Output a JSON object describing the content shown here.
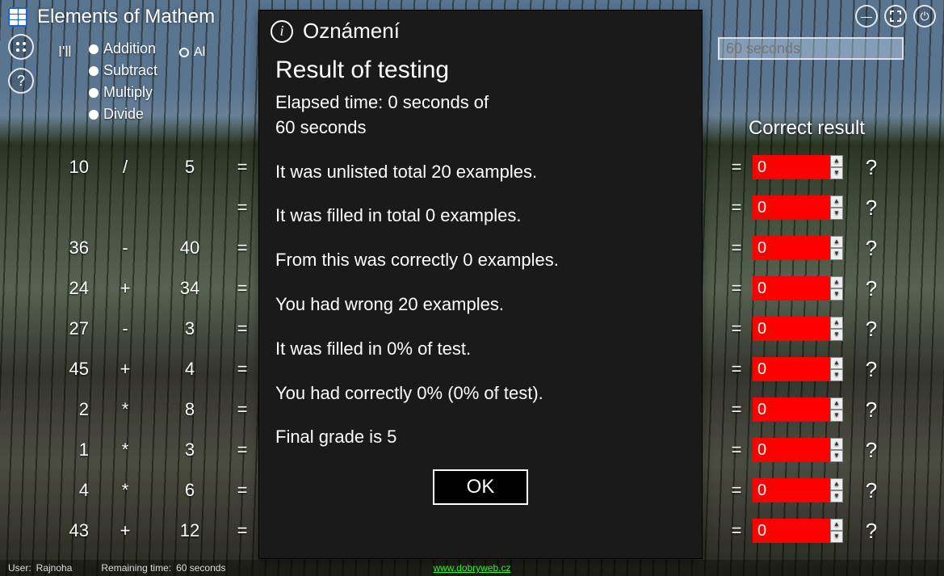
{
  "app": {
    "title": "Elements of Mathem",
    "options_label": "I'll",
    "operations": [
      "Addition",
      "Subtract",
      "Multiply",
      "Divide"
    ],
    "all_label": "Al"
  },
  "timer_placeholder": "60 seconds",
  "result_col_header": "Correct result",
  "exercises": [
    {
      "a": "10",
      "op": "/",
      "b": "5"
    },
    {
      "a": "",
      "op": "",
      "b": ""
    },
    {
      "a": "36",
      "op": "-",
      "b": "40"
    },
    {
      "a": "24",
      "op": "+",
      "b": "34"
    },
    {
      "a": "27",
      "op": "-",
      "b": "3"
    },
    {
      "a": "45",
      "op": "+",
      "b": "4"
    },
    {
      "a": "2",
      "op": "*",
      "b": "8"
    },
    {
      "a": "1",
      "op": "*",
      "b": "3"
    },
    {
      "a": "4",
      "op": "*",
      "b": "6"
    },
    {
      "a": "43",
      "op": "+",
      "b": "12"
    }
  ],
  "answer_default": "0",
  "qmark": "?",
  "eq": "=",
  "status": {
    "user_label": "User:",
    "user_name": "Rajnoha",
    "remaining_label": "Remaining time:",
    "remaining_value": "60 seconds",
    "link": "www.dobryweb.cz"
  },
  "modal": {
    "head": "Oznámení",
    "title": "Result of testing",
    "line_elapsed": "Elapsed time: 0 seconds of",
    "line_elapsed2": " 60 seconds",
    "line_total": "It was unlisted total 20 examples.",
    "line_filled": "It was filled in total 0 examples.",
    "line_correct": "From this was correctly 0 examples.",
    "line_wrong": "You had wrong 20 examples.",
    "line_pct": "It was filled in 0% of test.",
    "line_pct_correct": "You had correctly 0% (0% of test).",
    "line_grade": "Final grade is 5",
    "ok": "OK"
  },
  "icons": {
    "info": "i",
    "minimize": "—",
    "power": "⏻",
    "grid": "⠿",
    "help": "?"
  }
}
